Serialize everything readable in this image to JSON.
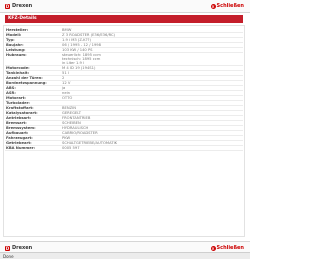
{
  "brand": {
    "name": "Drexen"
  },
  "close_label": "Schließen",
  "page_title": "KFZ-Details",
  "rows": [
    {
      "key": "Hersteller:",
      "lines": [
        "BMW"
      ]
    },
    {
      "key": "Modell:",
      "lines": [
        "Z 3 ROADSTER (E36/E36/RC)"
      ]
    },
    {
      "key": "Typ:",
      "lines": [
        "1.9 i M3 (Z-K??)"
      ]
    },
    {
      "key": "Baujahr:",
      "lines": [
        "06 / 1995 - 12 / 1998"
      ]
    },
    {
      "key": "Leistung:",
      "lines": [
        "103 KW / 140 PS"
      ]
    },
    {
      "key": "Hubraum:",
      "lines": [
        "steuerlich: 1895 ccm",
        "technisch: 1895 ccm",
        "in Liter   1.9 l"
      ]
    },
    {
      "key": "Motorcode:",
      "lines": [
        "M 4 ID 19 (194S1)"
      ]
    },
    {
      "key": "Tankinhalt:",
      "lines": [
        "51 l"
      ]
    },
    {
      "key": "Anzahl der Türen:",
      "lines": [
        "2"
      ]
    },
    {
      "key": "Bordnetzspannung:",
      "lines": [
        "12 V"
      ]
    },
    {
      "key": "ABS:",
      "lines": [
        "ja"
      ]
    },
    {
      "key": "ASR:",
      "lines": [
        "nein"
      ]
    },
    {
      "key": "Motorart:",
      "lines": [
        "OTTO"
      ]
    },
    {
      "key": "Turbolader:",
      "lines": [
        ""
      ]
    },
    {
      "key": "Kraftstoffart:",
      "lines": [
        "BENZIN"
      ]
    },
    {
      "key": "Katalysatorart:",
      "lines": [
        "GEREGELT"
      ]
    },
    {
      "key": "Antriebsart:",
      "lines": [
        "FRONTANTRIEB"
      ]
    },
    {
      "key": "Bremsart:",
      "lines": [
        "SCHEIBEN"
      ]
    },
    {
      "key": "Bremssystem:",
      "lines": [
        "HYDRAULISCH"
      ]
    },
    {
      "key": "Aufbauart:",
      "lines": [
        "CABRIO/ROADSTER"
      ]
    },
    {
      "key": "Fahrzeugart:",
      "lines": [
        "PKW"
      ]
    },
    {
      "key": "Getriebeart:",
      "lines": [
        "SCHALTGETRIEBE/AUTOMATIK"
      ]
    },
    {
      "key": "KBA Nummer:",
      "lines": [
        "0005 597"
      ]
    }
  ],
  "status_text": "Done",
  "colors": {
    "accent": "#c41e2a"
  }
}
